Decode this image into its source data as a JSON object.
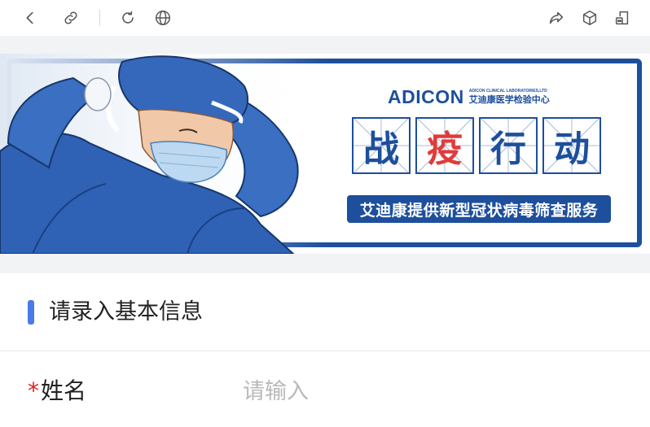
{
  "toolbar": {
    "left": [
      "back-icon",
      "link-icon",
      "refresh-icon",
      "globe-icon"
    ],
    "right": [
      "share-icon",
      "cube-icon",
      "mini-program-icon"
    ]
  },
  "banner": {
    "brand_logo": "ADICON",
    "brand_en": "ADICON CLINICAL LABORATORIES,LTD",
    "brand_cn": "艾迪康医学检验中心",
    "slogan": [
      "战",
      "疫",
      "行",
      "动"
    ],
    "slogan_highlight_index": 1,
    "service": "艾迪康提供新型冠状病毒筛查服务"
  },
  "section": {
    "title": "请录入基本信息"
  },
  "form": {
    "name_required_mark": "*",
    "name_label": "姓名",
    "name_value": "",
    "name_placeholder": "请输入"
  },
  "colors": {
    "brand_blue": "#1d4f9c",
    "accent_red": "#e23a3a",
    "marker_blue": "#4a7ae8",
    "required_red": "#e02020",
    "band_gray": "#f2f3f5"
  }
}
